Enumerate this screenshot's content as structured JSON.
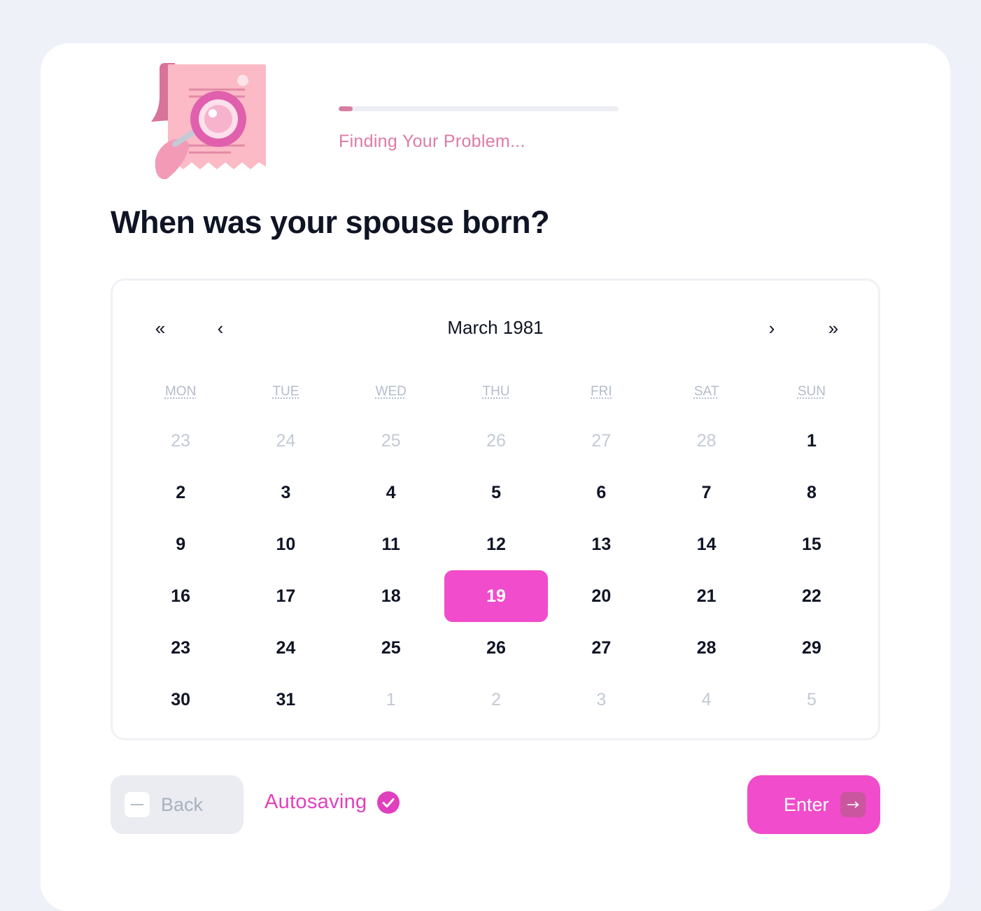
{
  "header": {
    "status_text": "Finding Your Problem...",
    "progress": 0.05
  },
  "question": "When was your spouse born?",
  "calendar": {
    "month_label": "March 1981",
    "nav": {
      "prev_year": "«",
      "prev_month": "‹",
      "next_month": "›",
      "next_year": "»"
    },
    "weekdays": [
      "MON",
      "TUE",
      "WED",
      "THU",
      "FRI",
      "SAT",
      "SUN"
    ],
    "selected_day": "19",
    "days": [
      {
        "label": "23",
        "muted": true
      },
      {
        "label": "24",
        "muted": true
      },
      {
        "label": "25",
        "muted": true
      },
      {
        "label": "26",
        "muted": true
      },
      {
        "label": "27",
        "muted": true
      },
      {
        "label": "28",
        "muted": true
      },
      {
        "label": "1",
        "muted": false
      },
      {
        "label": "2",
        "muted": false
      },
      {
        "label": "3",
        "muted": false
      },
      {
        "label": "4",
        "muted": false
      },
      {
        "label": "5",
        "muted": false
      },
      {
        "label": "6",
        "muted": false
      },
      {
        "label": "7",
        "muted": false
      },
      {
        "label": "8",
        "muted": false
      },
      {
        "label": "9",
        "muted": false
      },
      {
        "label": "10",
        "muted": false
      },
      {
        "label": "11",
        "muted": false
      },
      {
        "label": "12",
        "muted": false
      },
      {
        "label": "13",
        "muted": false
      },
      {
        "label": "14",
        "muted": false
      },
      {
        "label": "15",
        "muted": false
      },
      {
        "label": "16",
        "muted": false
      },
      {
        "label": "17",
        "muted": false
      },
      {
        "label": "18",
        "muted": false
      },
      {
        "label": "19",
        "muted": false,
        "selected": true
      },
      {
        "label": "20",
        "muted": false
      },
      {
        "label": "21",
        "muted": false
      },
      {
        "label": "22",
        "muted": false
      },
      {
        "label": "23",
        "muted": false
      },
      {
        "label": "24",
        "muted": false
      },
      {
        "label": "25",
        "muted": false
      },
      {
        "label": "26",
        "muted": false
      },
      {
        "label": "27",
        "muted": false
      },
      {
        "label": "28",
        "muted": false
      },
      {
        "label": "29",
        "muted": false
      },
      {
        "label": "30",
        "muted": false
      },
      {
        "label": "31",
        "muted": false
      },
      {
        "label": "1",
        "muted": true
      },
      {
        "label": "2",
        "muted": true
      },
      {
        "label": "3",
        "muted": true
      },
      {
        "label": "4",
        "muted": true
      },
      {
        "label": "5",
        "muted": true
      }
    ]
  },
  "footer": {
    "back_label": "Back",
    "autosave_label": "Autosaving",
    "enter_label": "Enter"
  },
  "colors": {
    "accent": "#f04ccb",
    "accent_text": "#e040bd",
    "status_pink": "#dc7ba6",
    "muted_text": "#c3cad6"
  },
  "icons": {
    "illustration": "receipt-magnifier-illustration",
    "back": "back-keycap-icon",
    "autosave": "check-circle-icon",
    "enter": "arrow-right-keycap-icon"
  }
}
